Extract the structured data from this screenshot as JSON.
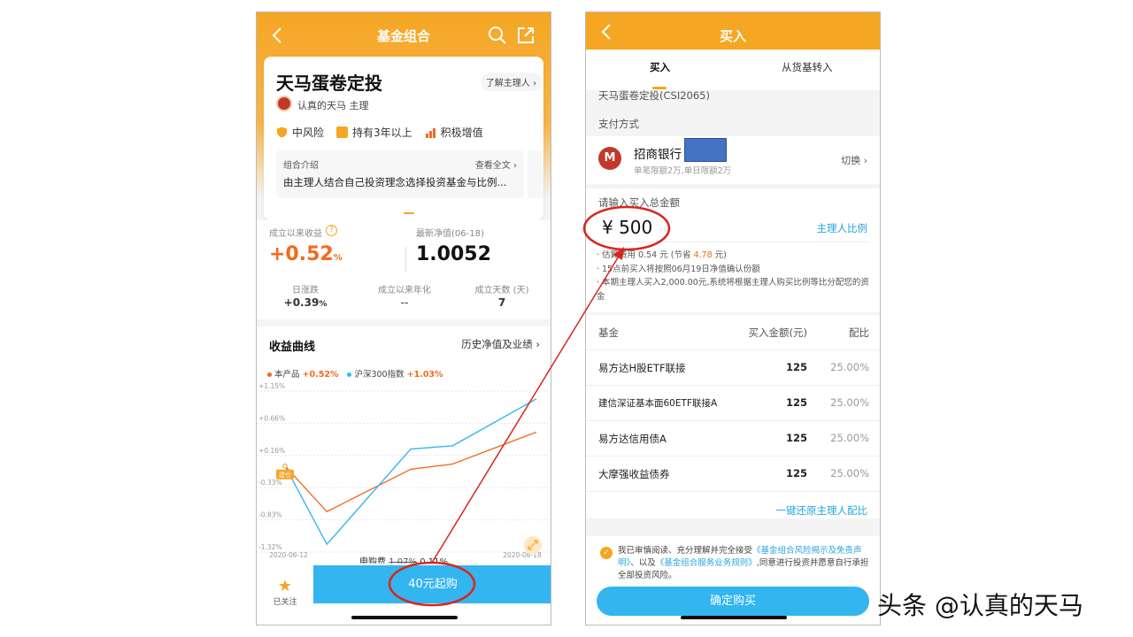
{
  "left_phone": {
    "header": {
      "title": "基金组合"
    },
    "card": {
      "fund_name": "天马蛋卷定投",
      "manager_button": "了解主理人 ›",
      "manager_name": "认真的天马",
      "manager_role": "主理",
      "tags": [
        "中风险",
        "持有3年以上",
        "积极增值"
      ],
      "intro_label": "组合介绍",
      "intro_more": "查看全文 ›",
      "intro_text": "由主理人结合自己投资理念选择投资基金与比例..."
    },
    "stats": {
      "return_label": "成立以来收益",
      "return_value": "+0.52",
      "return_unit": "%",
      "nav_label": "最新净值(06-18)",
      "nav_value": "1.0052",
      "daily_label": "日涨跌",
      "daily_value": "+0.39",
      "daily_unit": "%",
      "annual_label": "成立以来年化",
      "annual_value": "--",
      "days_label": "成立天数 (天)",
      "days_value": "7"
    },
    "chart_section": {
      "title": "收益曲线",
      "history_link": "历史净值及业绩 ›",
      "badge": "建仓"
    },
    "fee": {
      "label": "申购费",
      "original": "1.07%",
      "discounted": "0.11%"
    },
    "bottom": {
      "follow_label": "已关注",
      "buy_label": "40元起购"
    }
  },
  "chart_data": {
    "type": "line",
    "title": "",
    "x": [
      "2020-06-12",
      "2020-06-13",
      "2020-06-14",
      "2020-06-15",
      "2020-06-16",
      "2020-06-17",
      "2020-06-18"
    ],
    "x_tick_labels": [
      "2020-06-12",
      "2020-06-18"
    ],
    "y_tick_labels": [
      "+1.15%",
      "+0.66%",
      "+0.16%",
      "-0.33%",
      "-0.83%",
      "-1.32%"
    ],
    "ylim": [
      -1.32,
      1.15
    ],
    "series": [
      {
        "name": "本产品",
        "total_label": "+0.52%",
        "color": "#f26b1d",
        "values": [
          0.0,
          -0.7,
          null,
          -0.05,
          0.03,
          null,
          0.52
        ]
      },
      {
        "name": "沪深300指数",
        "total_label": "+1.03%",
        "color": "#33b5ef",
        "values": [
          0.0,
          -1.2,
          null,
          0.26,
          0.31,
          null,
          1.03
        ]
      }
    ]
  },
  "right_phone": {
    "header": {
      "title": "买入"
    },
    "tabs": [
      "买入",
      "从货基转入"
    ],
    "fund_id": "天马蛋卷定投(CSI2065)",
    "payment_label": "支付方式",
    "bank": {
      "logo": "M",
      "name": "招商银行",
      "limit": "单笔限额2万,单日限额2万",
      "switch": "切换 ›"
    },
    "amount": {
      "label": "请输入买入总金额",
      "value": "¥ 500",
      "ratio_link": "主理人比例",
      "note1_pre": "· 估算费用 0.54 元 (节省 ",
      "note1_save": "4.78",
      "note1_post": " 元)",
      "note2": "· 15点前买入将按照06月19日净值确认份额",
      "note3": "· 本期主理人买入2,000.00元,系统将根据主理人购买比例等比分配您的资金"
    },
    "table": {
      "headers": [
        "基金",
        "买入金额(元)",
        "配比"
      ],
      "rows": [
        {
          "name": "易方达H股ETF联接",
          "amount": "125",
          "ratio": "25.00%"
        },
        {
          "name": "建信深证基本面60ETF联接A",
          "amount": "125",
          "ratio": "25.00%"
        },
        {
          "name": "易方达信用债A",
          "amount": "125",
          "ratio": "25.00%"
        },
        {
          "name": "大摩强收益债券",
          "amount": "125",
          "ratio": "25.00%"
        }
      ],
      "restore": "一键还原主理人配比"
    },
    "agreement": {
      "prefix": "我已审慎阅读、充分理解并完全接受",
      "link1": "《基金组合风险揭示及免责声明》",
      "mid": "、以及",
      "link2": "《基金组合服务业务规则》",
      "suffix": ",同意进行投资并愿意自行承担全部投资风险。"
    },
    "confirm": "确定购买"
  },
  "watermark": "头条 @认真的天马",
  "colors": {
    "brand_orange": "#f5a623",
    "blue_button": "#33b5ef",
    "annotation_red": "#d9251c"
  }
}
